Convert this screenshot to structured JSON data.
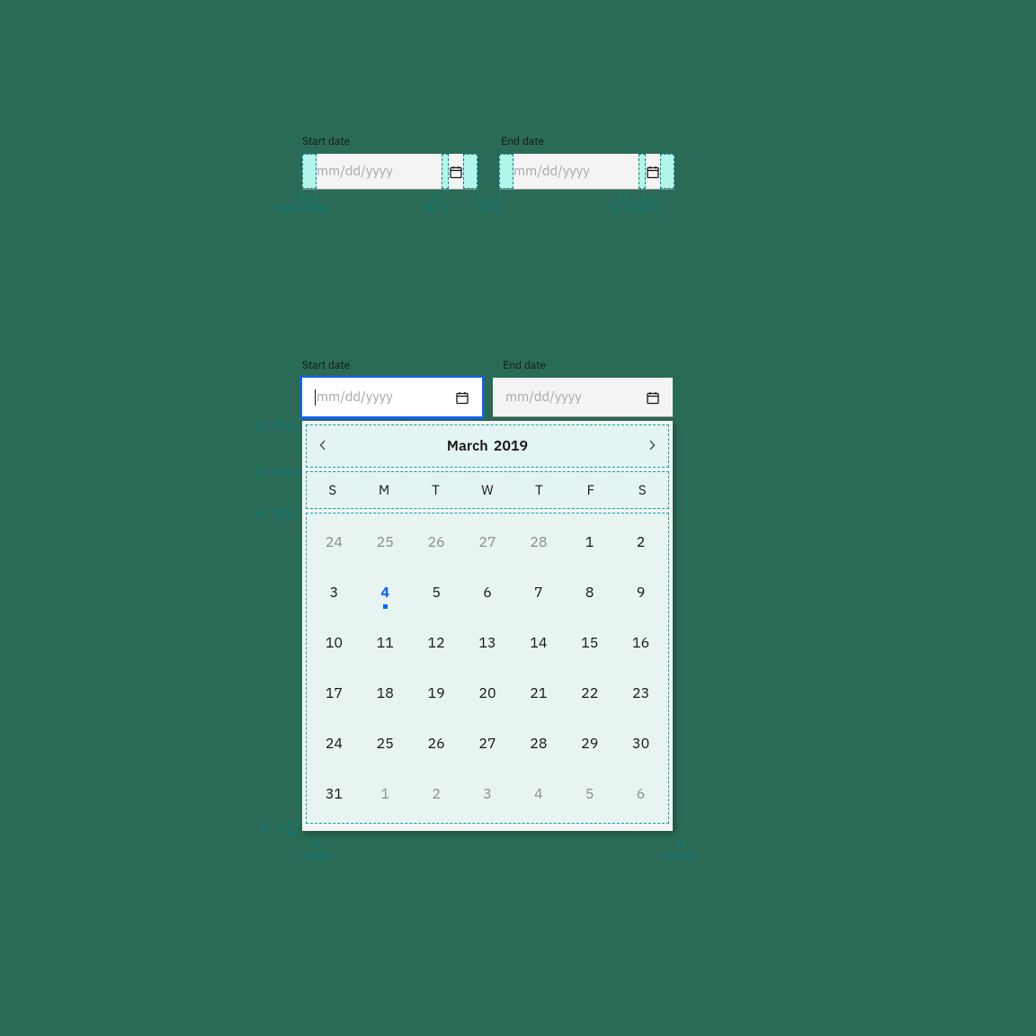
{
  "topSpec": {
    "labels": {
      "start": "Start date",
      "end": "End date"
    },
    "placeholder": "mm/dd/yyyy",
    "dims": {
      "left": "16px/1rem",
      "iconGap": "8/.5",
      "fieldGap": "16/1",
      "iconGap2": "8/.5",
      "right": "16/1"
    }
  },
  "bottomSpec": {
    "labels": {
      "start": "Start date",
      "end": "End date"
    },
    "placeholder": "mm/dd/yyyy"
  },
  "calendar": {
    "monthLabel": "March",
    "yearLabel": "2019",
    "dow": [
      "S",
      "M",
      "T",
      "W",
      "T",
      "F",
      "S"
    ],
    "days": [
      {
        "n": 24,
        "other": true
      },
      {
        "n": 25,
        "other": true
      },
      {
        "n": 26,
        "other": true
      },
      {
        "n": 27,
        "other": true
      },
      {
        "n": 28,
        "other": true
      },
      {
        "n": 1
      },
      {
        "n": 2
      },
      {
        "n": 3
      },
      {
        "n": 4,
        "today": true
      },
      {
        "n": 5
      },
      {
        "n": 6
      },
      {
        "n": 7
      },
      {
        "n": 8
      },
      {
        "n": 9
      },
      {
        "n": 10
      },
      {
        "n": 11
      },
      {
        "n": 12
      },
      {
        "n": 13
      },
      {
        "n": 14
      },
      {
        "n": 15
      },
      {
        "n": 16
      },
      {
        "n": 17
      },
      {
        "n": 18
      },
      {
        "n": 19
      },
      {
        "n": 20
      },
      {
        "n": 21
      },
      {
        "n": 22
      },
      {
        "n": 23
      },
      {
        "n": 24
      },
      {
        "n": 25
      },
      {
        "n": 26
      },
      {
        "n": 27
      },
      {
        "n": 28
      },
      {
        "n": 29
      },
      {
        "n": 30
      },
      {
        "n": 31
      },
      {
        "n": 1,
        "other": true
      },
      {
        "n": 2,
        "other": true
      },
      {
        "n": 3,
        "other": true
      },
      {
        "n": 4,
        "other": true
      },
      {
        "n": 5,
        "other": true
      },
      {
        "n": 6,
        "other": true
      }
    ],
    "measures": {
      "rowGap1": "4/.25",
      "rowGap2": "4/.25",
      "rowGap3": "4/.25",
      "bottomPad": "8/.5",
      "sidePadL": "4/.25",
      "sidePadR": "4/.25"
    }
  }
}
